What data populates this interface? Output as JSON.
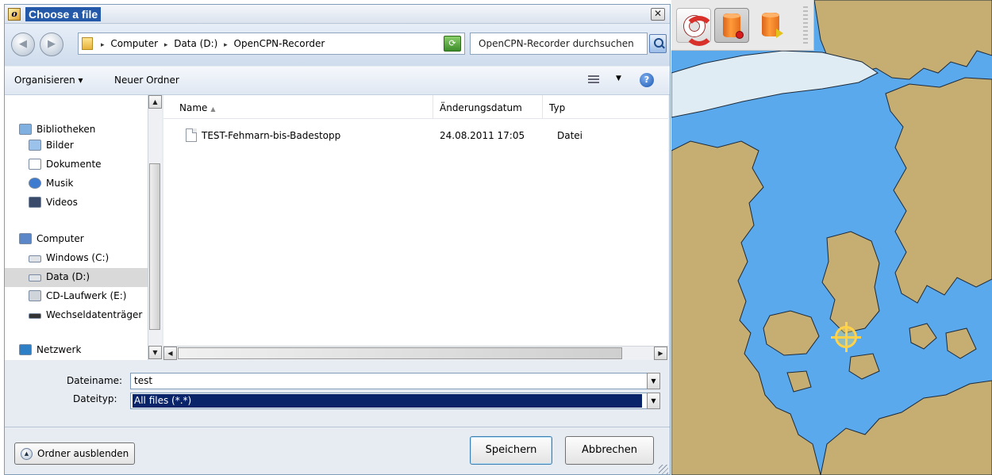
{
  "dialog": {
    "title": "Choose a file",
    "close_glyph": "✕",
    "address": {
      "crumbs": [
        "Computer",
        "Data (D:)",
        "OpenCPN-Recorder"
      ],
      "separator": "▸"
    },
    "search_placeholder": "OpenCPN-Recorder durchsuchen",
    "toolbar": {
      "organize_label": "Organisieren ▾",
      "new_folder_label": "Neuer Ordner"
    },
    "nav_items": [
      {
        "label": "Bibliotheken",
        "icon": "library-icon",
        "selected": false
      },
      {
        "label": "Bilder",
        "icon": "pictures-icon",
        "selected": false
      },
      {
        "label": "Dokumente",
        "icon": "documents-icon",
        "selected": false
      },
      {
        "label": "Musik",
        "icon": "music-icon",
        "selected": false
      },
      {
        "label": "Videos",
        "icon": "videos-icon",
        "selected": false
      },
      {
        "label": "Computer",
        "icon": "computer-icon",
        "selected": false
      },
      {
        "label": "Windows (C:)",
        "icon": "drive-icon",
        "selected": false
      },
      {
        "label": "Data (D:)",
        "icon": "drive-icon",
        "selected": true
      },
      {
        "label": "CD-Laufwerk (E:)",
        "icon": "cd-drive-icon",
        "selected": false
      },
      {
        "label": "Wechseldatenträger",
        "icon": "removable-drive-icon",
        "selected": false
      },
      {
        "label": "Netzwerk",
        "icon": "network-icon",
        "selected": false
      }
    ],
    "columns": {
      "name": "Name",
      "date": "Änderungsdatum",
      "type": "Typ"
    },
    "files": [
      {
        "name": "TEST-Fehmarn-bis-Badestopp",
        "date": "24.08.2011 17:05",
        "type": "Datei"
      }
    ],
    "form": {
      "filename_label": "Dateiname:",
      "filename_value": "test",
      "filetype_label": "Dateityp:",
      "filetype_value": "All files (*.*)"
    },
    "buttons": {
      "hide_folders": "Ordner ausblenden",
      "save": "Speichern",
      "cancel": "Abbrechen"
    }
  },
  "chart_panel": {
    "colors": {
      "water": "#5aa9ec",
      "land": "#c6ad72",
      "shallow": "#e0ecf4",
      "coast": "#1c2a3a"
    },
    "toolbar_icons": [
      "lifering-icon",
      "record-icon",
      "play-recording-icon"
    ]
  }
}
